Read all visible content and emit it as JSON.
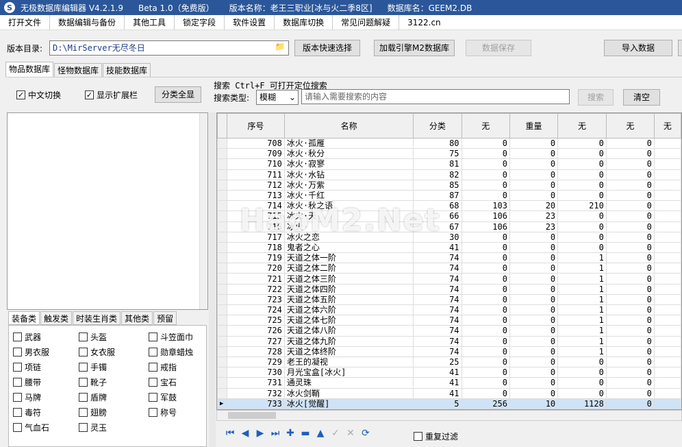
{
  "titlebar": {
    "app_title": "无极数据库编辑器 V4.2.1.9",
    "beta": "Beta 1.0（免费版）",
    "version_name": "版本名称：老王三职业[冰与火二季8区]",
    "db_name": "数据库名：GEEM2.DB"
  },
  "menu": [
    "打开文件",
    "数据编辑与备份",
    "其他工具",
    "锁定字段",
    "软件设置",
    "数据库切换",
    "常见问题解疑",
    "3122.cn"
  ],
  "toolbar": {
    "dir_label": "版本目录:",
    "dir_value": "D:\\MirServer无尽冬日",
    "quick_select": "版本快速选择",
    "load_engine": "加载引擎M2数据库",
    "save_data": "数据保存",
    "import_data": "导入数据"
  },
  "db_tabs": [
    "物品数据库",
    "怪物数据库",
    "技能数据库"
  ],
  "options": {
    "chinese_switch": "中文切换",
    "show_ext": "显示扩展栏",
    "show_all": "分类全显"
  },
  "search": {
    "group_title": "搜索  Ctrl+F 可打开定位搜索",
    "type_label": "搜索类型:",
    "type_value": "模糊",
    "placeholder": "请输入需要搜索的内容",
    "search_btn": "搜索",
    "clear_btn": "清空"
  },
  "category_tabs": [
    "装备类",
    "触发类",
    "时装生肖类",
    "其他类",
    "预留"
  ],
  "categories": [
    [
      "武器",
      "头盔",
      "斗笠面巾"
    ],
    [
      "男衣服",
      "女衣服",
      "勋章蜡烛"
    ],
    [
      "项链",
      "手镯",
      "戒指"
    ],
    [
      "腰带",
      "靴子",
      "宝石"
    ],
    [
      "马牌",
      "盾牌",
      "军鼓"
    ],
    [
      "毒符",
      "翅膀",
      "称号"
    ],
    [
      "气血石",
      "灵玉",
      ""
    ]
  ],
  "grid": {
    "columns": [
      "序号",
      "名称",
      "分类",
      "无",
      "重量",
      "无",
      "无",
      "无"
    ],
    "rows": [
      [
        "708",
        "冰火·孤雁",
        "80",
        "0",
        "0",
        "0",
        "0"
      ],
      [
        "709",
        "冰火·秋分",
        "75",
        "0",
        "0",
        "0",
        "0"
      ],
      [
        "710",
        "冰火·寂寥",
        "81",
        "0",
        "0",
        "0",
        "0"
      ],
      [
        "711",
        "冰火·水钻",
        "82",
        "0",
        "0",
        "0",
        "0"
      ],
      [
        "712",
        "冰火·万紫",
        "85",
        "0",
        "0",
        "0",
        "0"
      ],
      [
        "713",
        "冰火·千红",
        "87",
        "0",
        "0",
        "0",
        "0"
      ],
      [
        "714",
        "冰火·秋之语",
        "68",
        "103",
        "20",
        "210",
        "0"
      ],
      [
        "715",
        "冰火·天",
        "66",
        "106",
        "23",
        "0",
        "0"
      ],
      [
        "716",
        "冰火·",
        "67",
        "106",
        "23",
        "0",
        "0"
      ],
      [
        "717",
        "冰火之恋",
        "30",
        "0",
        "0",
        "0",
        "0"
      ],
      [
        "718",
        "鬼者之心",
        "41",
        "0",
        "0",
        "0",
        "0"
      ],
      [
        "719",
        "天道之体一阶",
        "74",
        "0",
        "0",
        "1",
        "0"
      ],
      [
        "720",
        "天道之体二阶",
        "74",
        "0",
        "0",
        "1",
        "0"
      ],
      [
        "721",
        "天道之体三阶",
        "74",
        "0",
        "0",
        "1",
        "0"
      ],
      [
        "722",
        "天道之体四阶",
        "74",
        "0",
        "0",
        "1",
        "0"
      ],
      [
        "723",
        "天道之体五阶",
        "74",
        "0",
        "0",
        "1",
        "0"
      ],
      [
        "724",
        "天道之体六阶",
        "74",
        "0",
        "0",
        "1",
        "0"
      ],
      [
        "725",
        "天道之体七阶",
        "74",
        "0",
        "0",
        "1",
        "0"
      ],
      [
        "726",
        "天道之体八阶",
        "74",
        "0",
        "0",
        "1",
        "0"
      ],
      [
        "727",
        "天道之体九阶",
        "74",
        "0",
        "0",
        "1",
        "0"
      ],
      [
        "728",
        "天道之体终阶",
        "74",
        "0",
        "0",
        "1",
        "0"
      ],
      [
        "729",
        "老王的凝视",
        "25",
        "0",
        "0",
        "0",
        "0"
      ],
      [
        "730",
        "月光宝盒[冰火]",
        "41",
        "0",
        "0",
        "0",
        "0"
      ],
      [
        "731",
        "通灵珠",
        "41",
        "0",
        "0",
        "0",
        "0"
      ],
      [
        "732",
        "冰火剑鞘",
        "41",
        "0",
        "0",
        "0",
        "0"
      ],
      [
        "733",
        "冰火[觉醒]",
        "5",
        "256",
        "10",
        "1128",
        "0"
      ]
    ]
  },
  "nav": {
    "icons": [
      "first-icon",
      "prior-icon",
      "next-icon",
      "last-icon",
      "insert-icon",
      "delete-icon",
      "edit-icon",
      "post-icon",
      "cancel-icon",
      "refresh-icon"
    ],
    "dup_filter": "重复过滤"
  },
  "watermark": "HaoM2.Net",
  "colors": {
    "title_bg": "#2b579a",
    "selected_row": "#cfe3f7",
    "nav_blue": "#1f5fbf"
  }
}
